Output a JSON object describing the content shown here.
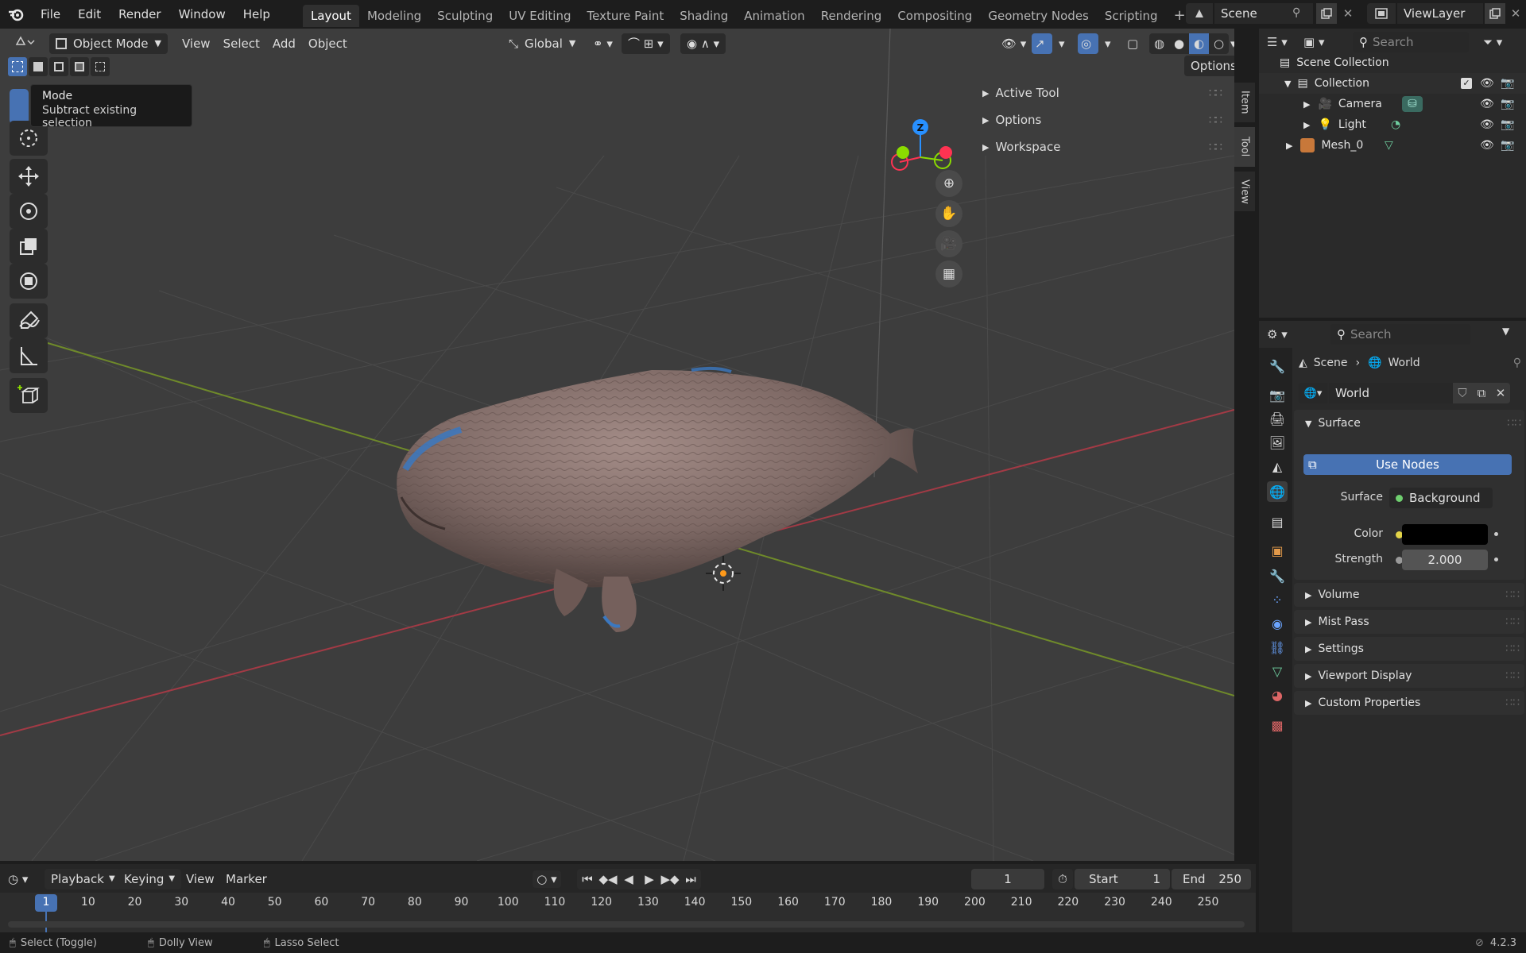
{
  "topbar": {
    "menus": [
      "File",
      "Edit",
      "Render",
      "Window",
      "Help"
    ],
    "workspaces": [
      "Layout",
      "Modeling",
      "Sculpting",
      "UV Editing",
      "Texture Paint",
      "Shading",
      "Animation",
      "Rendering",
      "Compositing",
      "Geometry Nodes",
      "Scripting"
    ],
    "active_workspace": "Layout",
    "scene": "Scene",
    "view_layer": "ViewLayer"
  },
  "viewport_header": {
    "mode": "Object Mode",
    "menus": [
      "View",
      "Select",
      "Add",
      "Object"
    ],
    "transform_orientation": "Global",
    "options_label": "Options"
  },
  "tooltip": {
    "title": "Mode",
    "description": "Subtract existing selection"
  },
  "npanel": {
    "sections": [
      "Active Tool",
      "Options",
      "Workspace"
    ],
    "tabs": [
      "Item",
      "Tool",
      "View"
    ]
  },
  "gizmo": {
    "axes": {
      "z": "Z",
      "x": "X",
      "y": "Y"
    },
    "colors": {
      "x": "#ff3352",
      "y": "#8bdc00",
      "z": "#2890ff"
    }
  },
  "outliner": {
    "search_placeholder": "Search",
    "root": "Scene Collection",
    "collection": "Collection",
    "items": [
      "Camera",
      "Light",
      "Mesh_0"
    ]
  },
  "properties": {
    "search_placeholder": "Search",
    "breadcrumb_scene": "Scene",
    "breadcrumb_world": "World",
    "datablock_name": "World",
    "surface_section": "Surface",
    "use_nodes": "Use Nodes",
    "surface_label": "Surface",
    "surface_value": "Background",
    "color_label": "Color",
    "color_value": "#000000",
    "strength_label": "Strength",
    "strength_value": "2.000",
    "collapsed_sections": [
      "Volume",
      "Mist Pass",
      "Settings",
      "Viewport Display",
      "Custom Properties"
    ]
  },
  "timeline": {
    "menus": [
      "Playback",
      "Keying",
      "View",
      "Marker"
    ],
    "current_frame": "1",
    "start_label": "Start",
    "start_value": "1",
    "end_label": "End",
    "end_value": "250",
    "ruler": [
      "1",
      "10",
      "20",
      "30",
      "40",
      "50",
      "60",
      "70",
      "80",
      "90",
      "100",
      "110",
      "120",
      "130",
      "140",
      "150",
      "160",
      "170",
      "180",
      "190",
      "200",
      "210",
      "220",
      "230",
      "240",
      "250"
    ]
  },
  "statusbar": {
    "hints": [
      "Select (Toggle)",
      "Dolly View",
      "Lasso Select"
    ],
    "version": "4.2.3"
  }
}
